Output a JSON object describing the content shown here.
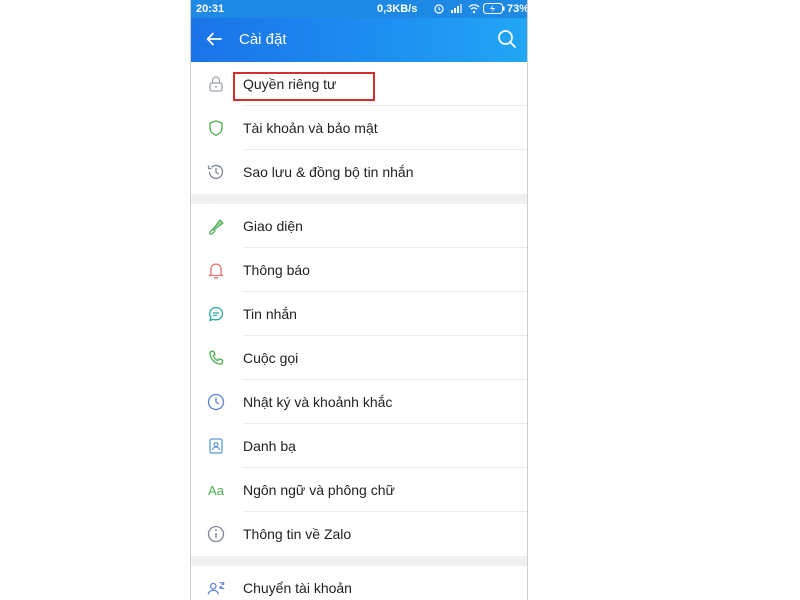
{
  "status_bar": {
    "time": "20:31",
    "speed": "0,3KB/s",
    "battery": "73%"
  },
  "app_bar": {
    "title": "Cài đặt",
    "back_icon": "arrow-left-icon",
    "search_icon": "search-icon"
  },
  "settings": {
    "groups": [
      [
        {
          "label": "Quyền riêng tư",
          "icon": "lock-icon",
          "highlighted": true
        },
        {
          "label": "Tài khoản và bảo mật",
          "icon": "shield-icon"
        },
        {
          "label": "Sao lưu & đồng bộ tin nhắn",
          "icon": "history-icon"
        }
      ],
      [
        {
          "label": "Giao diện",
          "icon": "brush-icon"
        },
        {
          "label": "Thông báo",
          "icon": "bell-icon"
        },
        {
          "label": "Tin nhắn",
          "icon": "chat-icon"
        },
        {
          "label": "Cuộc gọi",
          "icon": "phone-icon"
        },
        {
          "label": "Nhật ký và khoảnh khắc",
          "icon": "clock-icon"
        },
        {
          "label": "Danh bạ",
          "icon": "contact-icon"
        },
        {
          "label": "Ngôn ngữ và phông chữ",
          "icon": "font-icon",
          "icon_text": "Aa"
        },
        {
          "label": "Thông tin về Zalo",
          "icon": "info-icon"
        }
      ],
      [
        {
          "label": "Chuyển tài khoản",
          "icon": "switch-account-icon"
        }
      ]
    ]
  },
  "colors": {
    "primary": "#1e88e5",
    "highlight": "#d32f2f",
    "icon_gray": "#9aa3ad",
    "icon_green": "#4caf50",
    "icon_red": "#e57373",
    "icon_blue": "#5b7fd6"
  }
}
